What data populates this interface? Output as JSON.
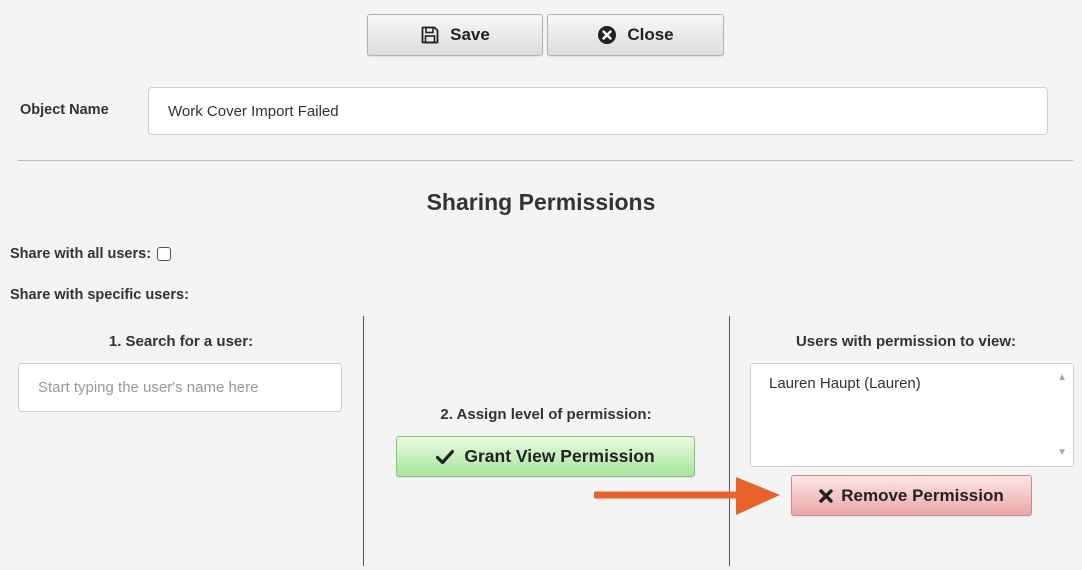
{
  "toolbar": {
    "save_label": "Save",
    "close_label": "Close"
  },
  "object": {
    "label": "Object Name",
    "value": "Work Cover Import Failed"
  },
  "sharing": {
    "heading": "Sharing Permissions",
    "share_all_label": "Share with all users:",
    "share_all_checked": false,
    "share_specific_label": "Share with specific users:"
  },
  "search": {
    "heading": "1. Search for a user:",
    "placeholder": "Start typing the user's name here"
  },
  "assign": {
    "heading": "2. Assign level of permission:",
    "grant_label": "Grant View Permission"
  },
  "users": {
    "heading": "Users with permission to view:",
    "items": [
      "Lauren Haupt (Lauren)"
    ],
    "remove_label": "Remove Permission"
  },
  "colors": {
    "annotation_arrow": "#e8622c",
    "grant_green": "#a7e59b",
    "remove_red": "#eba7a7"
  },
  "icons": {
    "save": "floppy-disk-icon",
    "close": "x-circle-icon",
    "grant": "checkmark-icon",
    "remove": "x-mark-icon",
    "annotation": "orange-arrow-icon"
  }
}
